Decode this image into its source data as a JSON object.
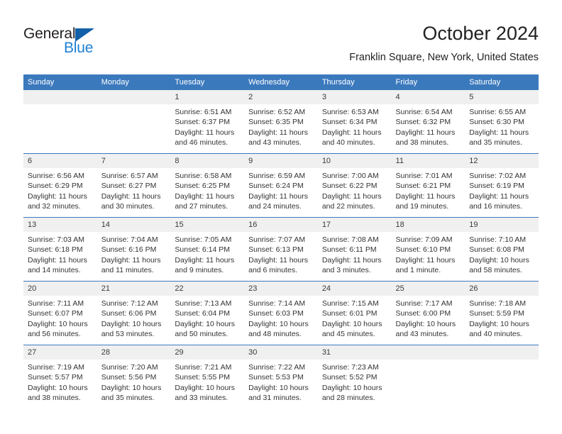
{
  "brand": {
    "name_part1": "General",
    "name_part2": "Blue",
    "color_dark": "#231f20",
    "color_blue": "#1f7fd4",
    "triangle_color": "#1260a8"
  },
  "header": {
    "title": "October 2024",
    "subtitle": "Franklin Square, New York, United States"
  },
  "theme": {
    "header_bar": "#3b79bd",
    "day_band": "#f0f0f0",
    "row_separator": "#3b79bd"
  },
  "columns": [
    "Sunday",
    "Monday",
    "Tuesday",
    "Wednesday",
    "Thursday",
    "Friday",
    "Saturday"
  ],
  "weeks": [
    [
      {
        "day": "",
        "info": ""
      },
      {
        "day": "",
        "info": ""
      },
      {
        "day": "1",
        "info": "Sunrise: 6:51 AM\nSunset: 6:37 PM\nDaylight: 11 hours\nand 46 minutes."
      },
      {
        "day": "2",
        "info": "Sunrise: 6:52 AM\nSunset: 6:35 PM\nDaylight: 11 hours\nand 43 minutes."
      },
      {
        "day": "3",
        "info": "Sunrise: 6:53 AM\nSunset: 6:34 PM\nDaylight: 11 hours\nand 40 minutes."
      },
      {
        "day": "4",
        "info": "Sunrise: 6:54 AM\nSunset: 6:32 PM\nDaylight: 11 hours\nand 38 minutes."
      },
      {
        "day": "5",
        "info": "Sunrise: 6:55 AM\nSunset: 6:30 PM\nDaylight: 11 hours\nand 35 minutes."
      }
    ],
    [
      {
        "day": "6",
        "info": "Sunrise: 6:56 AM\nSunset: 6:29 PM\nDaylight: 11 hours\nand 32 minutes."
      },
      {
        "day": "7",
        "info": "Sunrise: 6:57 AM\nSunset: 6:27 PM\nDaylight: 11 hours\nand 30 minutes."
      },
      {
        "day": "8",
        "info": "Sunrise: 6:58 AM\nSunset: 6:25 PM\nDaylight: 11 hours\nand 27 minutes."
      },
      {
        "day": "9",
        "info": "Sunrise: 6:59 AM\nSunset: 6:24 PM\nDaylight: 11 hours\nand 24 minutes."
      },
      {
        "day": "10",
        "info": "Sunrise: 7:00 AM\nSunset: 6:22 PM\nDaylight: 11 hours\nand 22 minutes."
      },
      {
        "day": "11",
        "info": "Sunrise: 7:01 AM\nSunset: 6:21 PM\nDaylight: 11 hours\nand 19 minutes."
      },
      {
        "day": "12",
        "info": "Sunrise: 7:02 AM\nSunset: 6:19 PM\nDaylight: 11 hours\nand 16 minutes."
      }
    ],
    [
      {
        "day": "13",
        "info": "Sunrise: 7:03 AM\nSunset: 6:18 PM\nDaylight: 11 hours\nand 14 minutes."
      },
      {
        "day": "14",
        "info": "Sunrise: 7:04 AM\nSunset: 6:16 PM\nDaylight: 11 hours\nand 11 minutes."
      },
      {
        "day": "15",
        "info": "Sunrise: 7:05 AM\nSunset: 6:14 PM\nDaylight: 11 hours\nand 9 minutes."
      },
      {
        "day": "16",
        "info": "Sunrise: 7:07 AM\nSunset: 6:13 PM\nDaylight: 11 hours\nand 6 minutes."
      },
      {
        "day": "17",
        "info": "Sunrise: 7:08 AM\nSunset: 6:11 PM\nDaylight: 11 hours\nand 3 minutes."
      },
      {
        "day": "18",
        "info": "Sunrise: 7:09 AM\nSunset: 6:10 PM\nDaylight: 11 hours\nand 1 minute."
      },
      {
        "day": "19",
        "info": "Sunrise: 7:10 AM\nSunset: 6:08 PM\nDaylight: 10 hours\nand 58 minutes."
      }
    ],
    [
      {
        "day": "20",
        "info": "Sunrise: 7:11 AM\nSunset: 6:07 PM\nDaylight: 10 hours\nand 56 minutes."
      },
      {
        "day": "21",
        "info": "Sunrise: 7:12 AM\nSunset: 6:06 PM\nDaylight: 10 hours\nand 53 minutes."
      },
      {
        "day": "22",
        "info": "Sunrise: 7:13 AM\nSunset: 6:04 PM\nDaylight: 10 hours\nand 50 minutes."
      },
      {
        "day": "23",
        "info": "Sunrise: 7:14 AM\nSunset: 6:03 PM\nDaylight: 10 hours\nand 48 minutes."
      },
      {
        "day": "24",
        "info": "Sunrise: 7:15 AM\nSunset: 6:01 PM\nDaylight: 10 hours\nand 45 minutes."
      },
      {
        "day": "25",
        "info": "Sunrise: 7:17 AM\nSunset: 6:00 PM\nDaylight: 10 hours\nand 43 minutes."
      },
      {
        "day": "26",
        "info": "Sunrise: 7:18 AM\nSunset: 5:59 PM\nDaylight: 10 hours\nand 40 minutes."
      }
    ],
    [
      {
        "day": "27",
        "info": "Sunrise: 7:19 AM\nSunset: 5:57 PM\nDaylight: 10 hours\nand 38 minutes."
      },
      {
        "day": "28",
        "info": "Sunrise: 7:20 AM\nSunset: 5:56 PM\nDaylight: 10 hours\nand 35 minutes."
      },
      {
        "day": "29",
        "info": "Sunrise: 7:21 AM\nSunset: 5:55 PM\nDaylight: 10 hours\nand 33 minutes."
      },
      {
        "day": "30",
        "info": "Sunrise: 7:22 AM\nSunset: 5:53 PM\nDaylight: 10 hours\nand 31 minutes."
      },
      {
        "day": "31",
        "info": "Sunrise: 7:23 AM\nSunset: 5:52 PM\nDaylight: 10 hours\nand 28 minutes."
      },
      {
        "day": "",
        "info": ""
      },
      {
        "day": "",
        "info": ""
      }
    ]
  ]
}
